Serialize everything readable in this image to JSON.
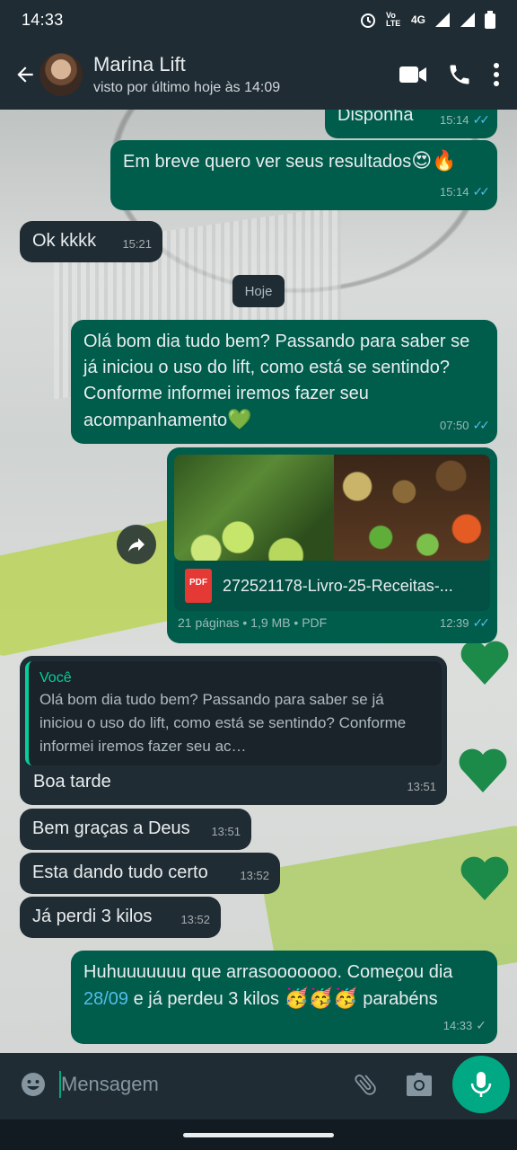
{
  "status_bar": {
    "time": "14:33",
    "network": "4G",
    "volte": "Vo LTE",
    "icons": [
      "alarm-icon",
      "volte-icon",
      "signal-icon",
      "signal-icon",
      "battery-icon"
    ]
  },
  "header": {
    "contact_name": "Marina Lift",
    "last_seen": "visto por último hoje às 14:09",
    "icons": [
      "back-arrow-icon",
      "video-call-icon",
      "phone-icon",
      "more-vert-icon"
    ]
  },
  "chat": {
    "day_separator": "Hoje",
    "messages": [
      {
        "dir": "out",
        "text": "Disponha",
        "time": "15:14",
        "status": "read"
      },
      {
        "dir": "out",
        "text": "Em breve quero ver seus resultados",
        "emoji": "😍🔥",
        "time": "15:14",
        "status": "read"
      },
      {
        "dir": "in",
        "text": "Ok kkkk",
        "time": "15:21"
      },
      {
        "dir": "out",
        "text": "Olá bom dia tudo bem? Passando para saber se já iniciou o uso do lift, como está se sentindo? Conforme informei iremos fazer seu acompanhamento",
        "emoji": "💚",
        "time": "07:50",
        "status": "read"
      },
      {
        "dir": "out",
        "type": "document",
        "file_name": "272521178-Livro-25-Receitas-...",
        "file_label": "PDF",
        "info": "21 páginas • 1,9 MB • PDF",
        "time": "12:39",
        "status": "read"
      },
      {
        "dir": "in",
        "quote_author": "Você",
        "quote_text": "Olá bom dia tudo bem? Passando para saber se já iniciou o uso do lift, como está se sentindo? Conforme informei iremos fazer seu ac…",
        "text": "Boa tarde",
        "time": "13:51"
      },
      {
        "dir": "in",
        "text": "Bem graças a Deus",
        "time": "13:51"
      },
      {
        "dir": "in",
        "text": "Esta dando tudo certo",
        "time": "13:52"
      },
      {
        "dir": "in",
        "text": "Já perdi 3 kilos",
        "time": "13:52"
      },
      {
        "dir": "out",
        "text_a": "Huhuuuuuuu que arrasooooooo.  Começou dia",
        "link": "28/09",
        "text_b": "e já perdeu 3 kilos",
        "emoji": "🥳🥳🥳",
        "text_c": "parabéns",
        "time": "14:33",
        "status": "delivered"
      }
    ]
  },
  "input": {
    "placeholder": "Mensagem",
    "icons": [
      "emoji-icon",
      "attach-icon",
      "camera-icon",
      "mic-icon"
    ]
  },
  "colors": {
    "outgoing_bubble": "#005c4b",
    "incoming_bubble": "#202c33",
    "header": "#1f2c34",
    "accent": "#00a884",
    "read_ticks": "#53bdeb"
  }
}
